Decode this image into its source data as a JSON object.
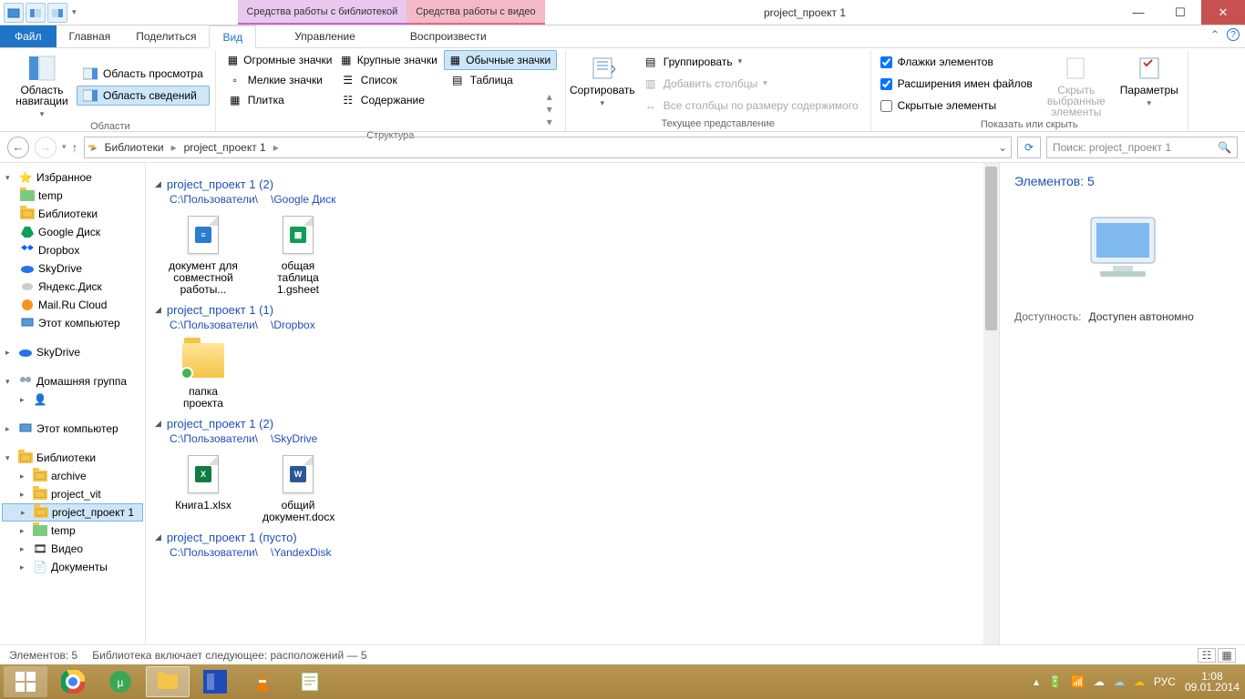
{
  "window": {
    "title": "project_проект 1",
    "context_tabs": {
      "library": "Средства работы с библиотекой",
      "video": "Средства работы с видео"
    }
  },
  "tabs": {
    "file": "Файл",
    "home": "Главная",
    "share": "Поделиться",
    "view": "Вид",
    "manage": "Управление",
    "play": "Воспроизвести"
  },
  "ribbon": {
    "panes": {
      "nav_pane": "Область навигации",
      "preview": "Область просмотра",
      "details_pane": "Область сведений",
      "group": "Области"
    },
    "layout": {
      "extra_large": "Огромные значки",
      "large": "Крупные значки",
      "medium": "Обычные значки",
      "small": "Мелкие значки",
      "list": "Список",
      "details": "Содержание",
      "tiles": "Плитка",
      "table": "Таблица",
      "group": "Структура"
    },
    "current": {
      "sort": "Сортировать",
      "group_by": "Группировать",
      "add_cols": "Добавить столбцы",
      "size_cols": "Все столбцы по размеру содержимого",
      "group": "Текущее представление"
    },
    "show": {
      "checkboxes": "Флажки элементов",
      "extensions": "Расширения имен файлов",
      "hidden": "Скрытые элементы",
      "hide_sel": "Скрыть выбранные элементы",
      "options": "Параметры",
      "group": "Показать или скрыть"
    }
  },
  "nav": {
    "crumbs": [
      "Библиотеки",
      "project_проект 1"
    ],
    "search_placeholder": "Поиск: project_проект 1"
  },
  "tree": {
    "favorites": "Избранное",
    "fav_items": [
      "temp",
      "Библиотеки",
      "Google Диск",
      "Dropbox",
      "SkyDrive",
      "Яндекс.Диск",
      "Mail.Ru Cloud",
      "Этот компьютер"
    ],
    "skydrive": "SkyDrive",
    "homegroup": "Домашняя группа",
    "thispc": "Этот компьютер",
    "libraries": "Библиотеки",
    "lib_items": [
      "archive",
      "project_vit",
      "project_проект 1",
      "temp",
      "Видео",
      "Документы"
    ]
  },
  "groups": [
    {
      "title": "project_проект 1 (2)",
      "path1": "C:\\Пользователи\\",
      "path2": "\\Google Диск",
      "items": [
        {
          "name": "документ для совместной работы...",
          "icon": "gdoc"
        },
        {
          "name": "общая таблица 1.gsheet",
          "icon": "gsheet"
        }
      ]
    },
    {
      "title": "project_проект 1 (1)",
      "path1": "C:\\Пользователи\\",
      "path2": "\\Dropbox",
      "items": [
        {
          "name": "папка проекта",
          "icon": "folder"
        }
      ]
    },
    {
      "title": "project_проект 1 (2)",
      "path1": "C:\\Пользователи\\",
      "path2": "\\SkyDrive",
      "items": [
        {
          "name": "Книга1.xlsx",
          "icon": "xlsx"
        },
        {
          "name": "общий документ.docx",
          "icon": "docx"
        }
      ]
    },
    {
      "title": "project_проект 1 (пусто)",
      "path1": "C:\\Пользователи\\",
      "path2": "\\YandexDisk",
      "items": []
    }
  ],
  "details": {
    "count_label": "Элементов: 5",
    "avail_k": "Доступность:",
    "avail_v": "Доступен автономно"
  },
  "status": {
    "count": "Элементов: 5",
    "library_info": "Библиотека включает следующее: расположений — 5"
  },
  "clock": {
    "time": "1:08",
    "date": "09.01.2014",
    "lang": "РУС"
  }
}
